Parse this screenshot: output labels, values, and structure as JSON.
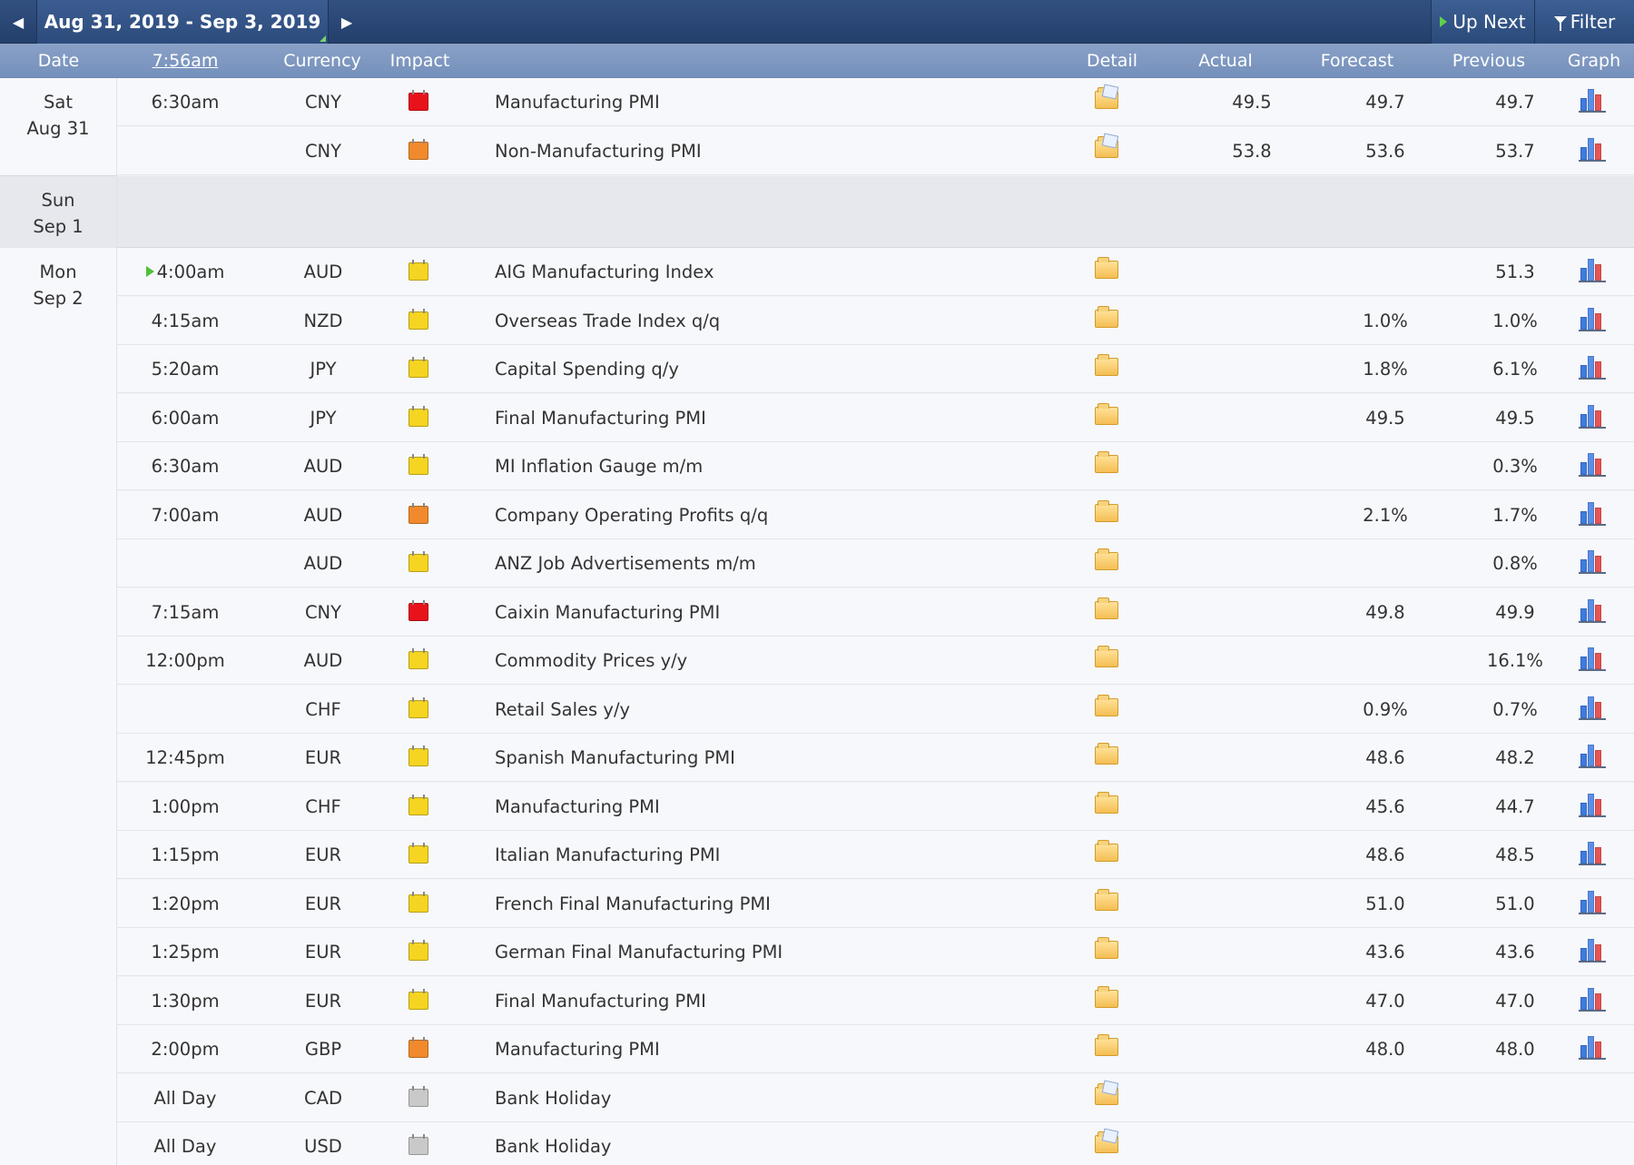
{
  "nav": {
    "range": "Aug 31, 2019 - Sep 3, 2019",
    "up_next": "Up Next",
    "filter": "Filter"
  },
  "columns": {
    "date": "Date",
    "time": "7:56am",
    "currency": "Currency",
    "impact": "Impact",
    "detail": "Detail",
    "actual": "Actual",
    "forecast": "Forecast",
    "previous": "Previous",
    "graph": "Graph"
  },
  "impact_colors": {
    "high": "#e8121b",
    "medium": "#f08a2c",
    "low": "#f5d422",
    "holiday": "#c9c9c9"
  },
  "days": [
    {
      "weekday": "Sat",
      "date": "Aug 31"
    },
    {
      "weekday": "Sun",
      "date": "Sep 1"
    },
    {
      "weekday": "Mon",
      "date": "Sep 2"
    }
  ],
  "events": [
    {
      "time": "6:30am",
      "currency": "CNY",
      "impact": "high",
      "event": "Manufacturing PMI",
      "actual": "49.5",
      "forecast": "49.7",
      "previous": "49.7",
      "detail_icon": "folder-open-icon",
      "graph": true
    },
    {
      "time": "",
      "currency": "CNY",
      "impact": "medium",
      "event": "Non-Manufacturing PMI",
      "actual": "53.8",
      "forecast": "53.6",
      "previous": "53.7",
      "detail_icon": "folder-open-icon",
      "graph": true
    },
    {
      "time": "4:00am",
      "next": true,
      "currency": "AUD",
      "impact": "low",
      "event": "AIG Manufacturing Index",
      "actual": "",
      "forecast": "",
      "previous": "51.3",
      "detail_icon": "folder-icon",
      "graph": true
    },
    {
      "time": "4:15am",
      "currency": "NZD",
      "impact": "low",
      "event": "Overseas Trade Index q/q",
      "actual": "",
      "forecast": "1.0%",
      "previous": "1.0%",
      "detail_icon": "folder-icon",
      "graph": true
    },
    {
      "time": "5:20am",
      "currency": "JPY",
      "impact": "low",
      "event": "Capital Spending q/y",
      "actual": "",
      "forecast": "1.8%",
      "previous": "6.1%",
      "detail_icon": "folder-icon",
      "graph": true
    },
    {
      "time": "6:00am",
      "currency": "JPY",
      "impact": "low",
      "event": "Final Manufacturing PMI",
      "actual": "",
      "forecast": "49.5",
      "previous": "49.5",
      "detail_icon": "folder-icon",
      "graph": true
    },
    {
      "time": "6:30am",
      "currency": "AUD",
      "impact": "low",
      "event": "MI Inflation Gauge m/m",
      "actual": "",
      "forecast": "",
      "previous": "0.3%",
      "detail_icon": "folder-icon",
      "graph": true
    },
    {
      "time": "7:00am",
      "currency": "AUD",
      "impact": "medium",
      "event": "Company Operating Profits q/q",
      "actual": "",
      "forecast": "2.1%",
      "previous": "1.7%",
      "detail_icon": "folder-icon",
      "graph": true
    },
    {
      "time": "",
      "currency": "AUD",
      "impact": "low",
      "event": "ANZ Job Advertisements m/m",
      "actual": "",
      "forecast": "",
      "previous": "0.8%",
      "detail_icon": "folder-icon",
      "graph": true
    },
    {
      "time": "7:15am",
      "currency": "CNY",
      "impact": "high",
      "event": "Caixin Manufacturing PMI",
      "actual": "",
      "forecast": "49.8",
      "previous": "49.9",
      "detail_icon": "folder-icon",
      "graph": true
    },
    {
      "time": "12:00pm",
      "currency": "AUD",
      "impact": "low",
      "event": "Commodity Prices y/y",
      "actual": "",
      "forecast": "",
      "previous": "16.1%",
      "detail_icon": "folder-icon",
      "graph": true
    },
    {
      "time": "",
      "currency": "CHF",
      "impact": "low",
      "event": "Retail Sales y/y",
      "actual": "",
      "forecast": "0.9%",
      "previous": "0.7%",
      "detail_icon": "folder-icon",
      "graph": true
    },
    {
      "time": "12:45pm",
      "currency": "EUR",
      "impact": "low",
      "event": "Spanish Manufacturing PMI",
      "actual": "",
      "forecast": "48.6",
      "previous": "48.2",
      "detail_icon": "folder-icon",
      "graph": true
    },
    {
      "time": "1:00pm",
      "currency": "CHF",
      "impact": "low",
      "event": "Manufacturing PMI",
      "actual": "",
      "forecast": "45.6",
      "previous": "44.7",
      "detail_icon": "folder-icon",
      "graph": true
    },
    {
      "time": "1:15pm",
      "currency": "EUR",
      "impact": "low",
      "event": "Italian Manufacturing PMI",
      "actual": "",
      "forecast": "48.6",
      "previous": "48.5",
      "detail_icon": "folder-icon",
      "graph": true
    },
    {
      "time": "1:20pm",
      "currency": "EUR",
      "impact": "low",
      "event": "French Final Manufacturing PMI",
      "actual": "",
      "forecast": "51.0",
      "previous": "51.0",
      "detail_icon": "folder-icon",
      "graph": true
    },
    {
      "time": "1:25pm",
      "currency": "EUR",
      "impact": "low",
      "event": "German Final Manufacturing PMI",
      "actual": "",
      "forecast": "43.6",
      "previous": "43.6",
      "detail_icon": "folder-icon",
      "graph": true
    },
    {
      "time": "1:30pm",
      "currency": "EUR",
      "impact": "low",
      "event": "Final Manufacturing PMI",
      "actual": "",
      "forecast": "47.0",
      "previous": "47.0",
      "detail_icon": "folder-icon",
      "graph": true
    },
    {
      "time": "2:00pm",
      "currency": "GBP",
      "impact": "medium",
      "event": "Manufacturing PMI",
      "actual": "",
      "forecast": "48.0",
      "previous": "48.0",
      "detail_icon": "folder-icon",
      "graph": true
    },
    {
      "time": "All Day",
      "currency": "CAD",
      "impact": "holiday",
      "event": "Bank Holiday",
      "actual": "",
      "forecast": "",
      "previous": "",
      "detail_icon": "folder-open-icon",
      "graph": false
    },
    {
      "time": "All Day",
      "currency": "USD",
      "impact": "holiday",
      "event": "Bank Holiday",
      "actual": "",
      "forecast": "",
      "previous": "",
      "detail_icon": "folder-open-icon",
      "graph": false
    }
  ]
}
